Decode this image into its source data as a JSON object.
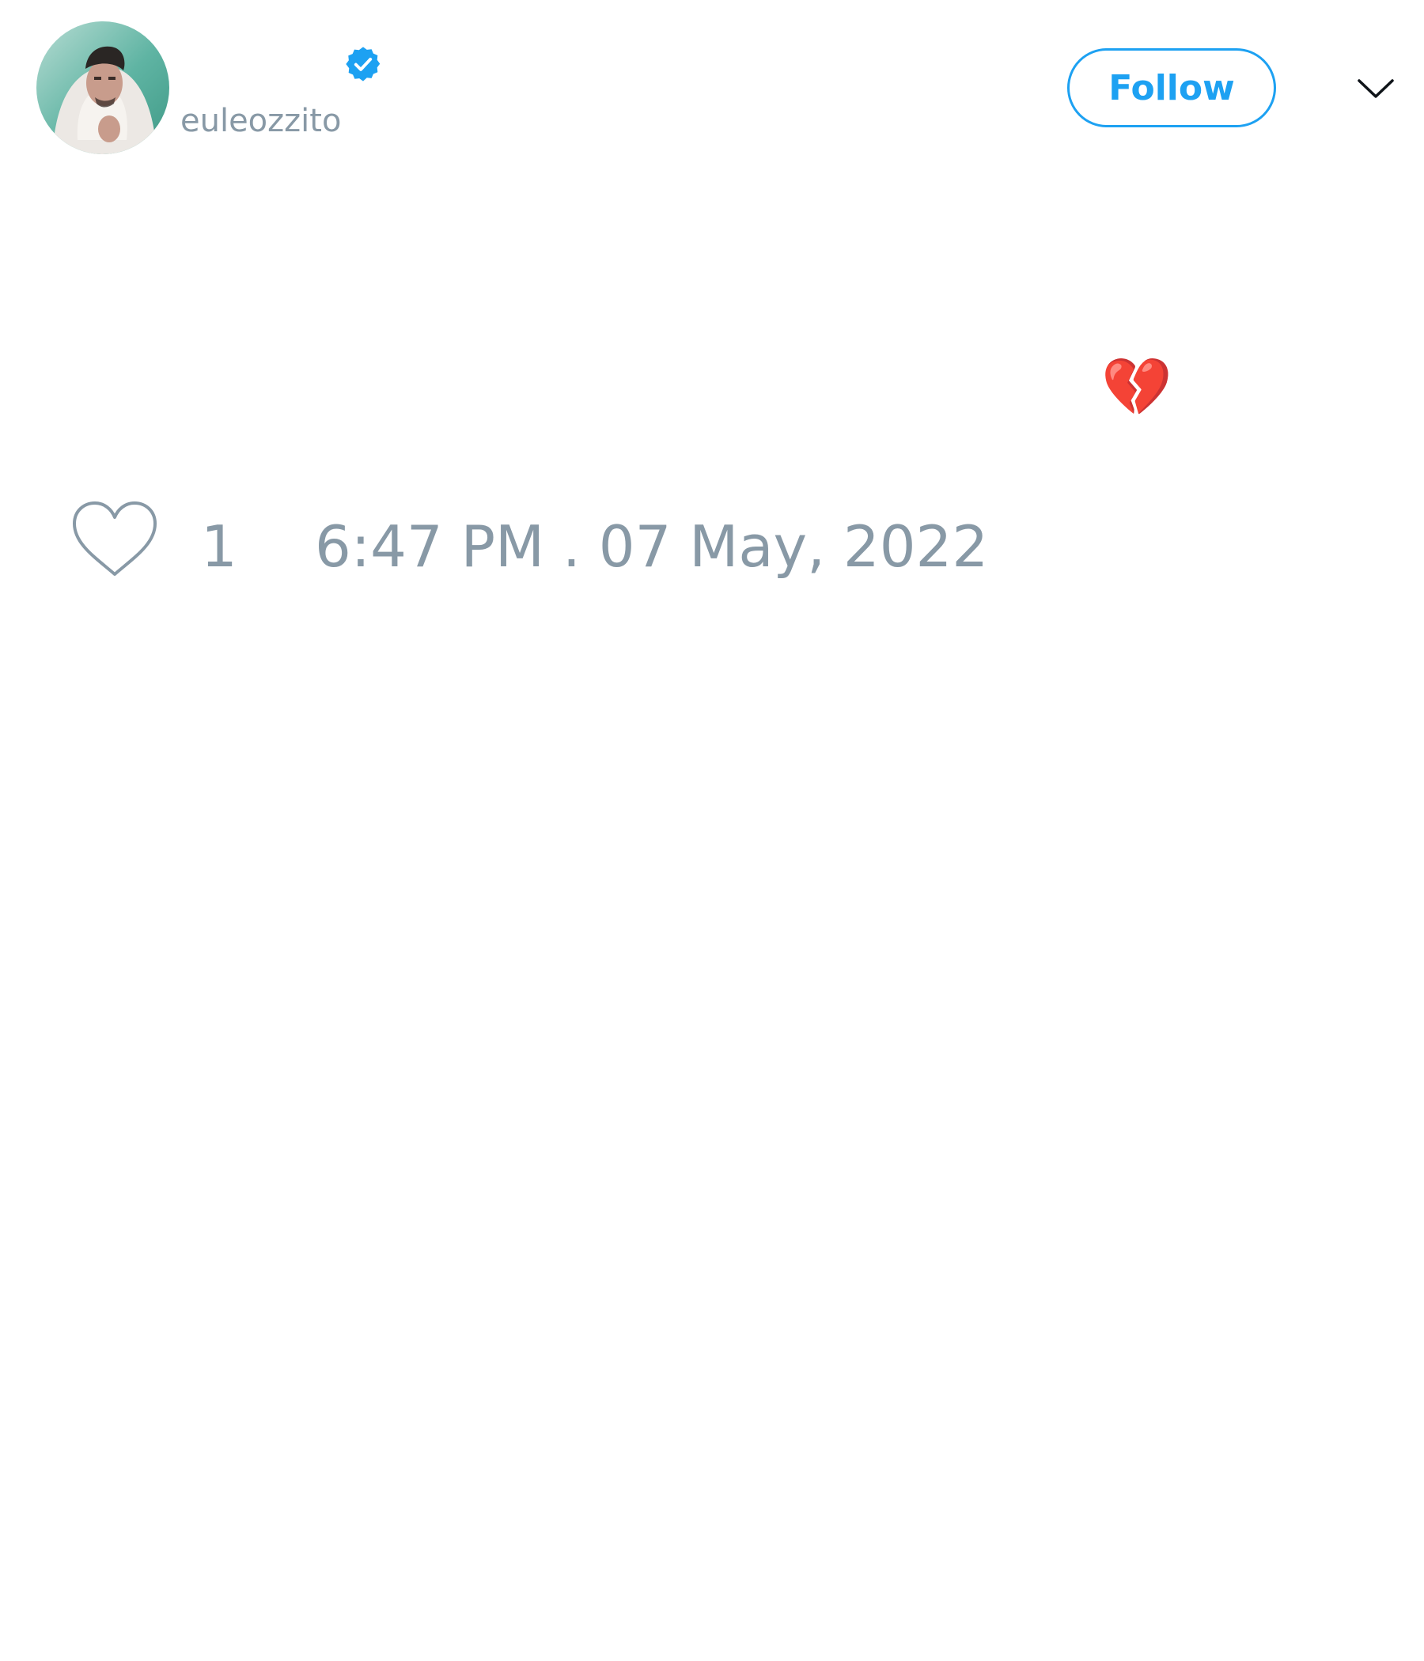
{
  "author": {
    "display_name": "",
    "handle": "euleozzito",
    "verified": true,
    "avatar_icon": "user-avatar"
  },
  "actions": {
    "follow_label": "Follow",
    "menu_icon": "chevron-down-icon"
  },
  "tweet": {
    "text": "💔",
    "like_count": "1",
    "timestamp": "6:47 PM . 07 May, 2022"
  },
  "colors": {
    "accent": "#1da1f2",
    "muted_text": "#8899a6",
    "primary_text": "#0f1419",
    "background": "#ffffff"
  }
}
